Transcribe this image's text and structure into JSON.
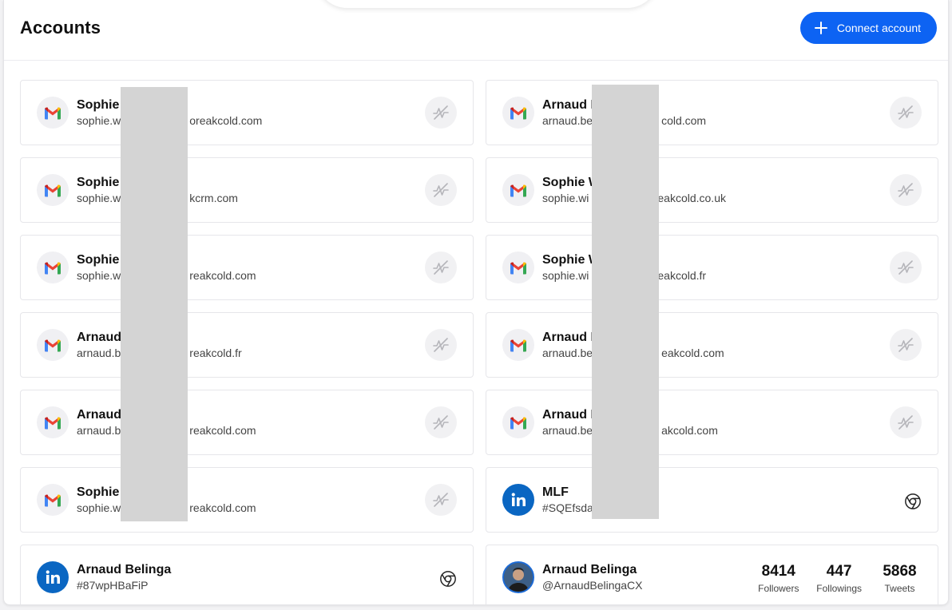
{
  "header": {
    "title": "Accounts",
    "connect_button_label": "Connect account"
  },
  "accent_color": "#0d63f3",
  "accounts": [
    {
      "type": "gmail",
      "name_visible": "Sophie",
      "email_prefix": "sophie.w",
      "email_suffix": "oreakcold.com",
      "status_icon": "activity-off-icon"
    },
    {
      "type": "gmail",
      "name_visible": "Arnaud B",
      "email_prefix": "arnaud.be",
      "email_suffix": "cold.com",
      "status_icon": "activity-off-icon"
    },
    {
      "type": "gmail",
      "name_visible": "Sophie",
      "email_prefix": "sophie.w",
      "email_suffix": "kcrm.com",
      "status_icon": "activity-off-icon"
    },
    {
      "type": "gmail",
      "name_visible": "Sophie W",
      "email_prefix": "sophie.wi",
      "email_suffix": "eakcold.co.uk",
      "status_icon": "activity-off-icon"
    },
    {
      "type": "gmail",
      "name_visible": "Sophie",
      "email_prefix": "sophie.w",
      "email_suffix": "reakcold.com",
      "status_icon": "activity-off-icon"
    },
    {
      "type": "gmail",
      "name_visible": "Sophie W",
      "email_prefix": "sophie.wi",
      "email_suffix": "eakcold.fr",
      "status_icon": "activity-off-icon"
    },
    {
      "type": "gmail",
      "name_visible": "Arnaud",
      "email_prefix": "arnaud.b",
      "email_suffix": "reakcold.fr",
      "status_icon": "activity-off-icon"
    },
    {
      "type": "gmail",
      "name_visible": "Arnaud B",
      "email_prefix": "arnaud.be",
      "email_suffix": "eakcold.com",
      "status_icon": "activity-off-icon"
    },
    {
      "type": "gmail",
      "name_visible": "Arnaud",
      "email_prefix": "arnaud.b",
      "email_suffix": "reakcold.com",
      "status_icon": "activity-off-icon"
    },
    {
      "type": "gmail",
      "name_visible": "Arnaud B",
      "email_prefix": "arnaud.be",
      "email_suffix": "akcold.com",
      "status_icon": "activity-off-icon"
    },
    {
      "type": "gmail",
      "name_visible": "Sophie",
      "email_prefix": "sophie.w",
      "email_suffix": "reakcold.com",
      "status_icon": "activity-off-icon"
    },
    {
      "type": "linkedin",
      "name_visible": "MLF",
      "email_prefix": "#SQEfsda",
      "email_suffix": "",
      "status_icon": "chrome-icon"
    },
    {
      "type": "linkedin",
      "name_visible": "Arnaud Belinga",
      "email_prefix": "#87wpHBaFiP",
      "email_suffix": "",
      "status_icon": "chrome-icon"
    },
    {
      "type": "twitter",
      "name_visible": "Arnaud Belinga",
      "email_prefix": "@ArnaudBelingaCX",
      "email_suffix": "",
      "stats": [
        {
          "value": "8414",
          "label": "Followers"
        },
        {
          "value": "447",
          "label": "Followings"
        },
        {
          "value": "5868",
          "label": "Tweets"
        }
      ]
    }
  ]
}
